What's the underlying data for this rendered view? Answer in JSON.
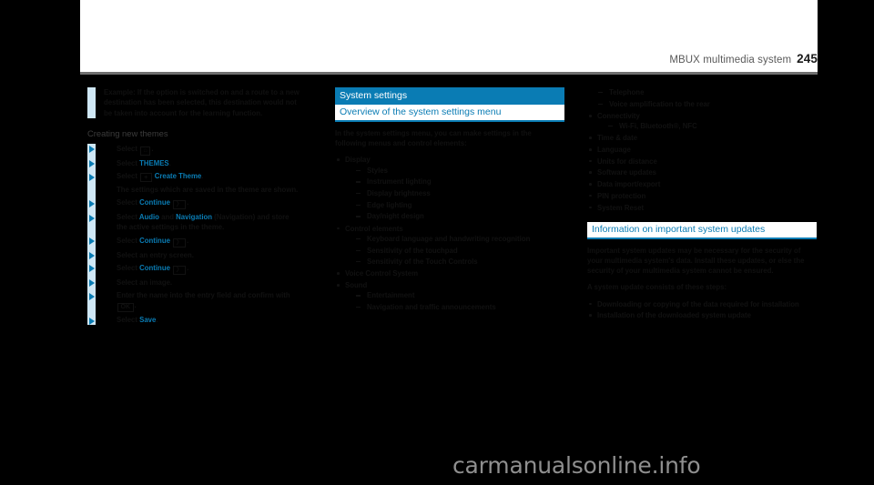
{
  "header": {
    "title": "MBUX multimedia system",
    "page_number": "245"
  },
  "left_column": {
    "note": "Example: If the option is switched on and a route to a new destination has been selected, this destination would not be taken into account for the learning function.",
    "section_heading": "Creating new themes",
    "steps": [
      {
        "prefix": "Select ",
        "key": "⌂",
        "suffix": "."
      },
      {
        "prefix": "Select ",
        "highlight": "THEMES",
        "suffix": "."
      },
      {
        "prefix": "Select ",
        "key": "+",
        "highlight": "Create Theme",
        "suffix": ".",
        "continuation": "The settings which are saved in the theme are shown."
      },
      {
        "prefix": "Select ",
        "highlight": "Continue",
        "key": "〉",
        "suffix": "."
      },
      {
        "prefix": "Select ",
        "highlight": "Audio",
        "mid": " and ",
        "highlight2": "Navigation",
        "suffix": " (Navigation) and store the active settings in the theme."
      },
      {
        "prefix": "Select ",
        "highlight": "Continue",
        "key": "〉",
        "suffix": "."
      },
      {
        "prefix": "Select an entry screen.",
        "suffix": ""
      },
      {
        "prefix": "Select ",
        "highlight": "Continue",
        "key": "〉",
        "suffix": "."
      },
      {
        "prefix": "Select an image.",
        "suffix": ""
      },
      {
        "prefix": "Enter the name into the entry field and confirm with ",
        "key": "OK",
        "suffix": "."
      },
      {
        "prefix": "Select ",
        "highlight": "Save",
        "suffix": "."
      }
    ]
  },
  "middle_column": {
    "section_title": "System settings",
    "section_subtitle": "Overview of the system settings menu",
    "intro": "In the system settings menu, you can make settings in the following menus and control elements:",
    "groups": [
      {
        "label": "Display",
        "items": [
          "Styles",
          "Instrument lighting",
          "Display brightness",
          "Edge lighting",
          "Day/night design"
        ]
      },
      {
        "label": "Control elements",
        "items": [
          "Keyboard language and handwriting recognition",
          "Sensitivity of the touchpad",
          "Sensitivity of the Touch Controls"
        ]
      },
      {
        "label": "Voice Control System",
        "items": []
      },
      {
        "label": "Sound",
        "items": [
          "Entertainment",
          "Navigation and traffic announcements"
        ]
      }
    ]
  },
  "right_column": {
    "continued_items": [
      "Telephone",
      "Voice amplification to the rear"
    ],
    "groups": [
      {
        "label": "Connectivity",
        "items": [
          "Wi-Fi, Bluetooth®, NFC"
        ]
      },
      {
        "label": "Time & date",
        "items": []
      },
      {
        "label": "Language",
        "items": []
      },
      {
        "label": "Units for distance",
        "items": []
      },
      {
        "label": "Software updates",
        "items": []
      },
      {
        "label": "Data import/export",
        "items": []
      },
      {
        "label": "PIN protection",
        "items": []
      },
      {
        "label": "System Reset",
        "items": []
      }
    ],
    "update_section": {
      "title": "Information on important system updates",
      "paragraph1": "Important system updates may be necessary for the security of your multimedia system's data. Install these updates, or else the security of your multimedia system cannot be ensured.",
      "paragraph2": "A system update consists of these steps:",
      "steps": [
        "Downloading or copying of the data required for installation",
        "Installation of the downloaded system update"
      ]
    }
  },
  "watermark": "carmanualsonline.info",
  "colors": {
    "accent": "#0a7cb4",
    "note_bar": "#cfe7f5",
    "page_bg": "#000000",
    "header_rule": "#6f6f6f"
  }
}
